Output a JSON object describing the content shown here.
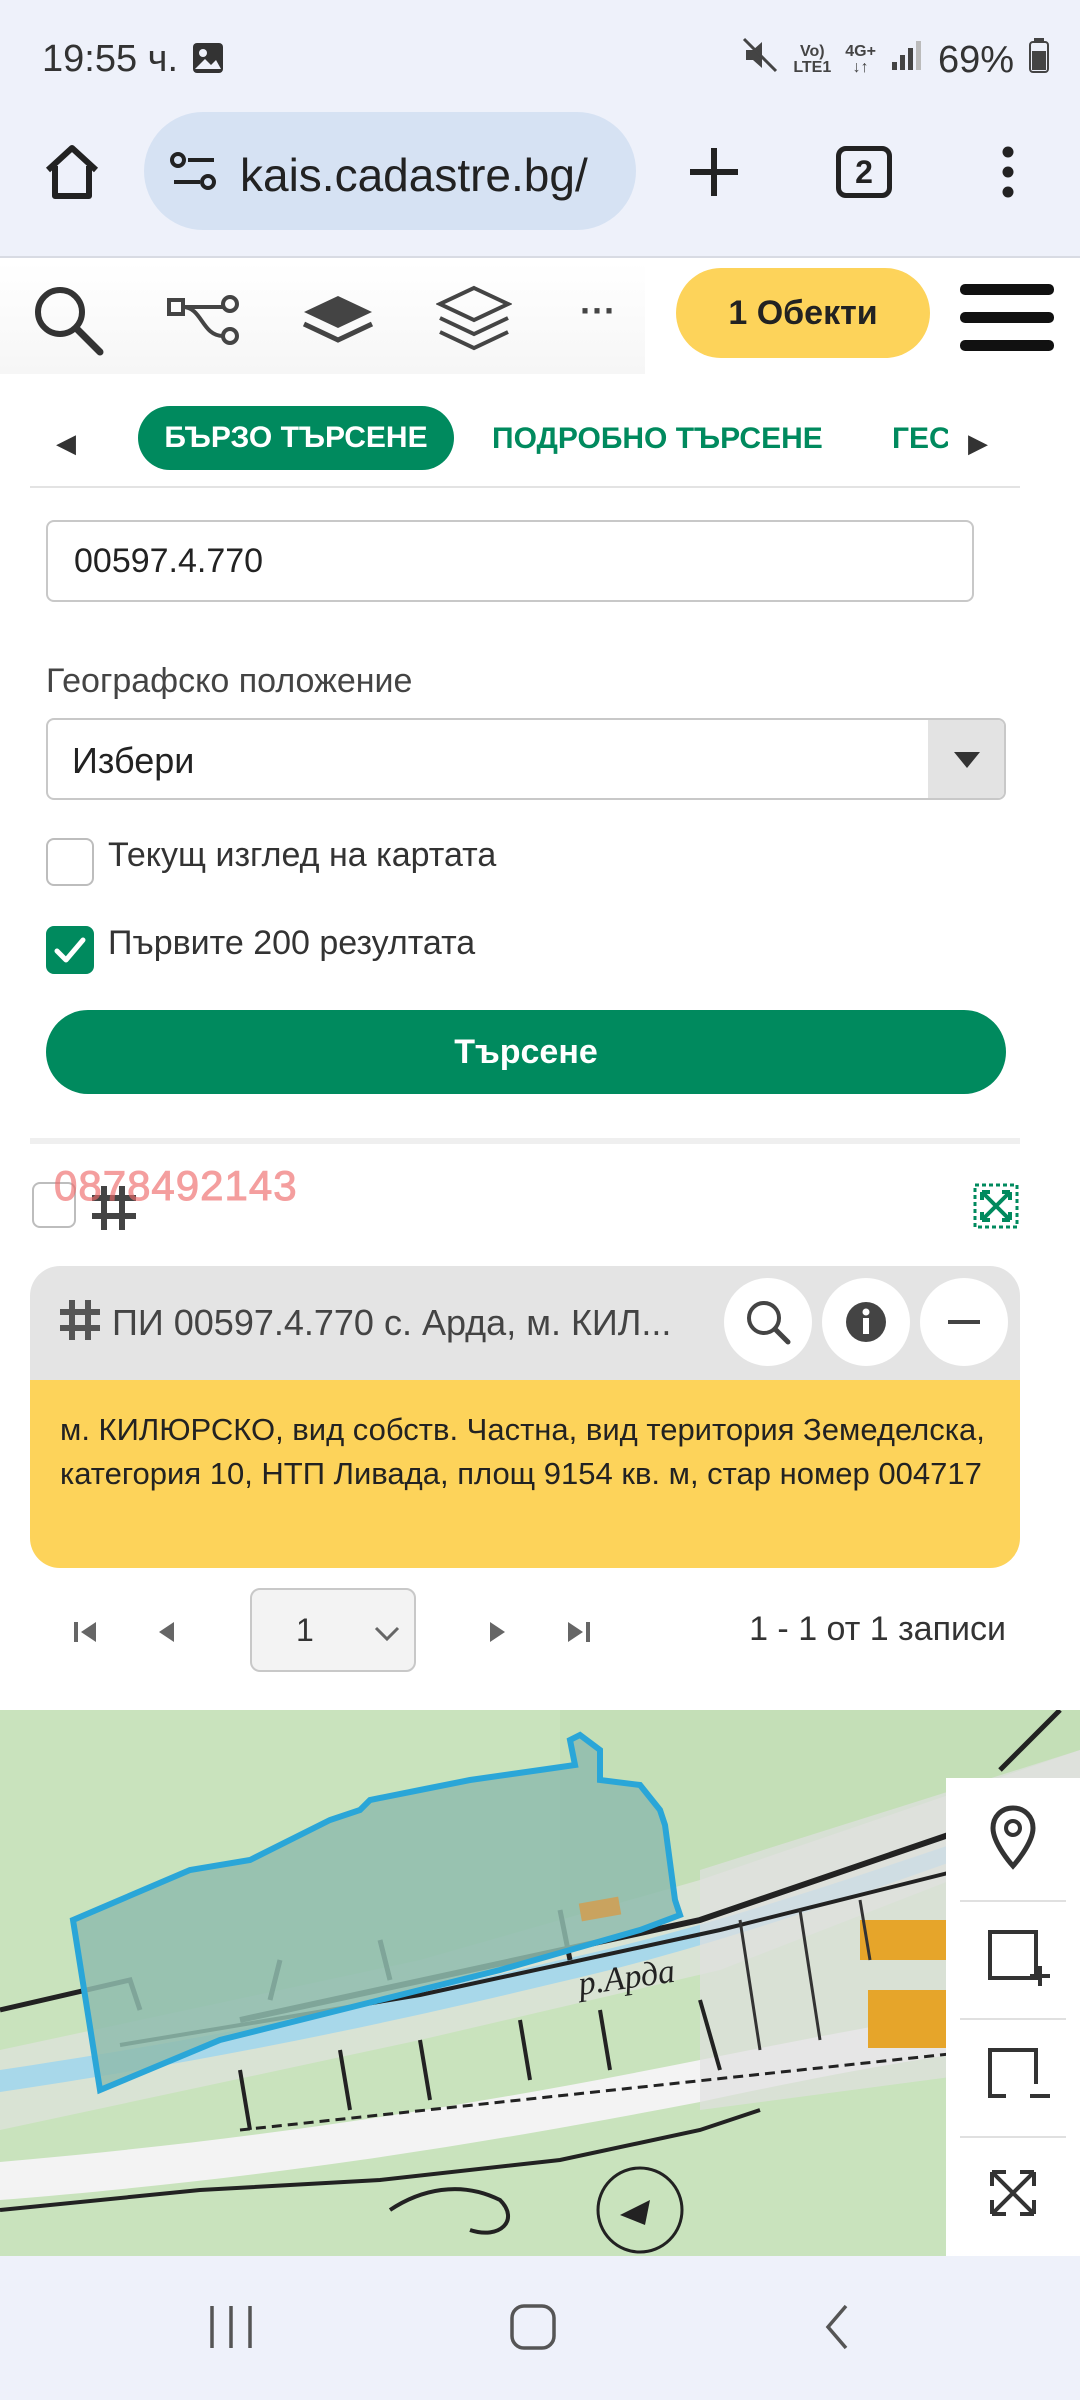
{
  "status_bar": {
    "time": "19:55 ч.",
    "network_top": "Vo)",
    "network_bottom": "LTE1",
    "network_4g": "4G+",
    "battery": "69%"
  },
  "browser": {
    "url": "kais.cadastre.bg/",
    "tabs_count": "2"
  },
  "toolbar": {
    "objects_label": "1 Обекти",
    "more_label": "···"
  },
  "tabs": {
    "quick": "БЪРЗО ТЪРСЕНЕ",
    "detailed": "ПОДРОБНО ТЪРСЕНЕ",
    "geo": "ГЕС"
  },
  "form": {
    "search_value": "00597.4.770",
    "geo_label": "Географско положение",
    "geo_select": "Избери",
    "current_view_label": "Текущ изглед на картата",
    "current_view_checked": false,
    "first200_label": "Първите 200 резултата",
    "first200_checked": true,
    "search_button": "Търсене"
  },
  "results": {
    "watermark": "0878492143",
    "title": "ПИ 00597.4.770 с. Арда, м. КИЛ...",
    "details": "м. КИЛЮРСКО, вид собств. Частна, вид територия Земеделска, категория 10, НТП Ливада, площ 9154 кв. м, стар номер 004717"
  },
  "pagination": {
    "page": "1",
    "records": "1 - 1 от 1 записи"
  },
  "map": {
    "river_label": "р.Арда"
  },
  "colors": {
    "primary": "#008a5e",
    "highlight": "#fdd35a",
    "parcel": "#2aa6d8"
  }
}
